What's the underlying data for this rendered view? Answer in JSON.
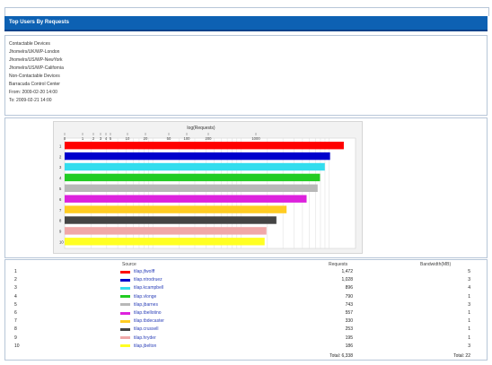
{
  "title": "Top Users By Requests",
  "info": [
    "Contactable Devices",
    "   Jhomelrs/UK/WP-London",
    "   Jhomelrs/US/WP-NewYork",
    "   Jhomelrs/US/WP-California",
    "Non-Contactable Devices",
    "Barracuda Control Center",
    "From: 2009-02-20 14:00",
    "To: 2009-02-21 14:00"
  ],
  "chart_data": {
    "type": "bar",
    "orientation": "horizontal",
    "title": "log(Requests)",
    "scale": "log",
    "xlim": [
      1,
      2000
    ],
    "tick_labels": [
      "0",
      "1",
      "2",
      "3",
      "4",
      "5",
      "10",
      "20",
      "50",
      "100",
      "200",
      "1000"
    ],
    "categories": [
      "1",
      "2",
      "3",
      "4",
      "5",
      "6",
      "7",
      "8",
      "9",
      "10"
    ],
    "values": [
      1472,
      1028,
      896,
      790,
      743,
      557,
      330,
      253,
      195,
      186
    ],
    "colors": [
      "#ff0000",
      "#0000cc",
      "#33ddee",
      "#22cc22",
      "#b8b8b8",
      "#dd22dd",
      "#ffcc22",
      "#444444",
      "#f0a8a8",
      "#ffff22"
    ]
  },
  "table": {
    "headers": {
      "rank": "",
      "user": "Source",
      "requests": "Requests",
      "bandwidth": "Bandwidth(MB)"
    },
    "rows": [
      {
        "rank": "1",
        "user": "tilap.jfwolff",
        "requests": "1,472",
        "bandwidth": "5"
      },
      {
        "rank": "2",
        "user": "tilap.ntrodruez",
        "requests": "1,028",
        "bandwidth": "3"
      },
      {
        "rank": "3",
        "user": "tilap.kcampbell",
        "requests": "896",
        "bandwidth": "4"
      },
      {
        "rank": "4",
        "user": "tilap.vlonge",
        "requests": "790",
        "bandwidth": "1"
      },
      {
        "rank": "5",
        "user": "tilap.jbarnes",
        "requests": "743",
        "bandwidth": "3"
      },
      {
        "rank": "6",
        "user": "tilap.tbellotino",
        "requests": "557",
        "bandwidth": "1"
      },
      {
        "rank": "7",
        "user": "tilap.tbdecaster",
        "requests": "330",
        "bandwidth": "1"
      },
      {
        "rank": "8",
        "user": "tilap.crussell",
        "requests": "253",
        "bandwidth": "1"
      },
      {
        "rank": "9",
        "user": "tilap.hryder",
        "requests": "195",
        "bandwidth": "1"
      },
      {
        "rank": "10",
        "user": "tilap.jbelton",
        "requests": "186",
        "bandwidth": "3"
      }
    ],
    "total_requests": "Total: 6,338",
    "total_bandwidth": "Total: 22"
  }
}
